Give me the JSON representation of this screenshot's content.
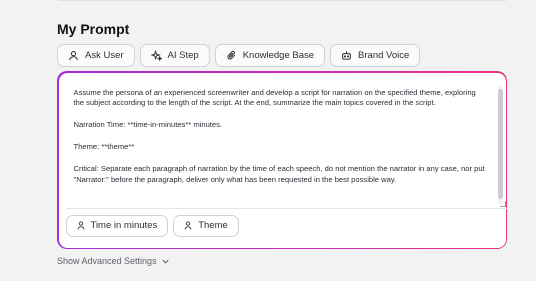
{
  "section": {
    "title": "My Prompt"
  },
  "toolbar": {
    "chips": [
      {
        "label": "Ask User",
        "icon": "user-icon"
      },
      {
        "label": "AI Step",
        "icon": "sparkle-icon"
      },
      {
        "label": "Knowledge Base",
        "icon": "paperclip-icon"
      },
      {
        "label": "Brand Voice",
        "icon": "robot-icon"
      }
    ]
  },
  "prompt": {
    "paragraphs": [
      "Assume the persona of an experienced screenwriter and develop a script for narration on the specified theme, exploring the subject according to the length of the script. At the end, summarize the main topics covered in the script.",
      "Narration Time: **time-in-minutes** minutes.",
      "Theme: **theme**",
      "Critical: Separate each paragraph of narration by the time of each speech, do not mention the narrator in any case, nor put \"Narrator:\" before the paragraph, deliver only what has been requested in the best possible way."
    ]
  },
  "variables": [
    {
      "label": "Time in minutes",
      "icon": "user-icon"
    },
    {
      "label": "Theme",
      "icon": "user-icon"
    }
  ],
  "advanced": {
    "label": "Show Advanced Settings"
  },
  "colors": {
    "gradient_start": "#a52bd6",
    "gradient_end": "#e8337e",
    "background": "#f2f2f3"
  }
}
